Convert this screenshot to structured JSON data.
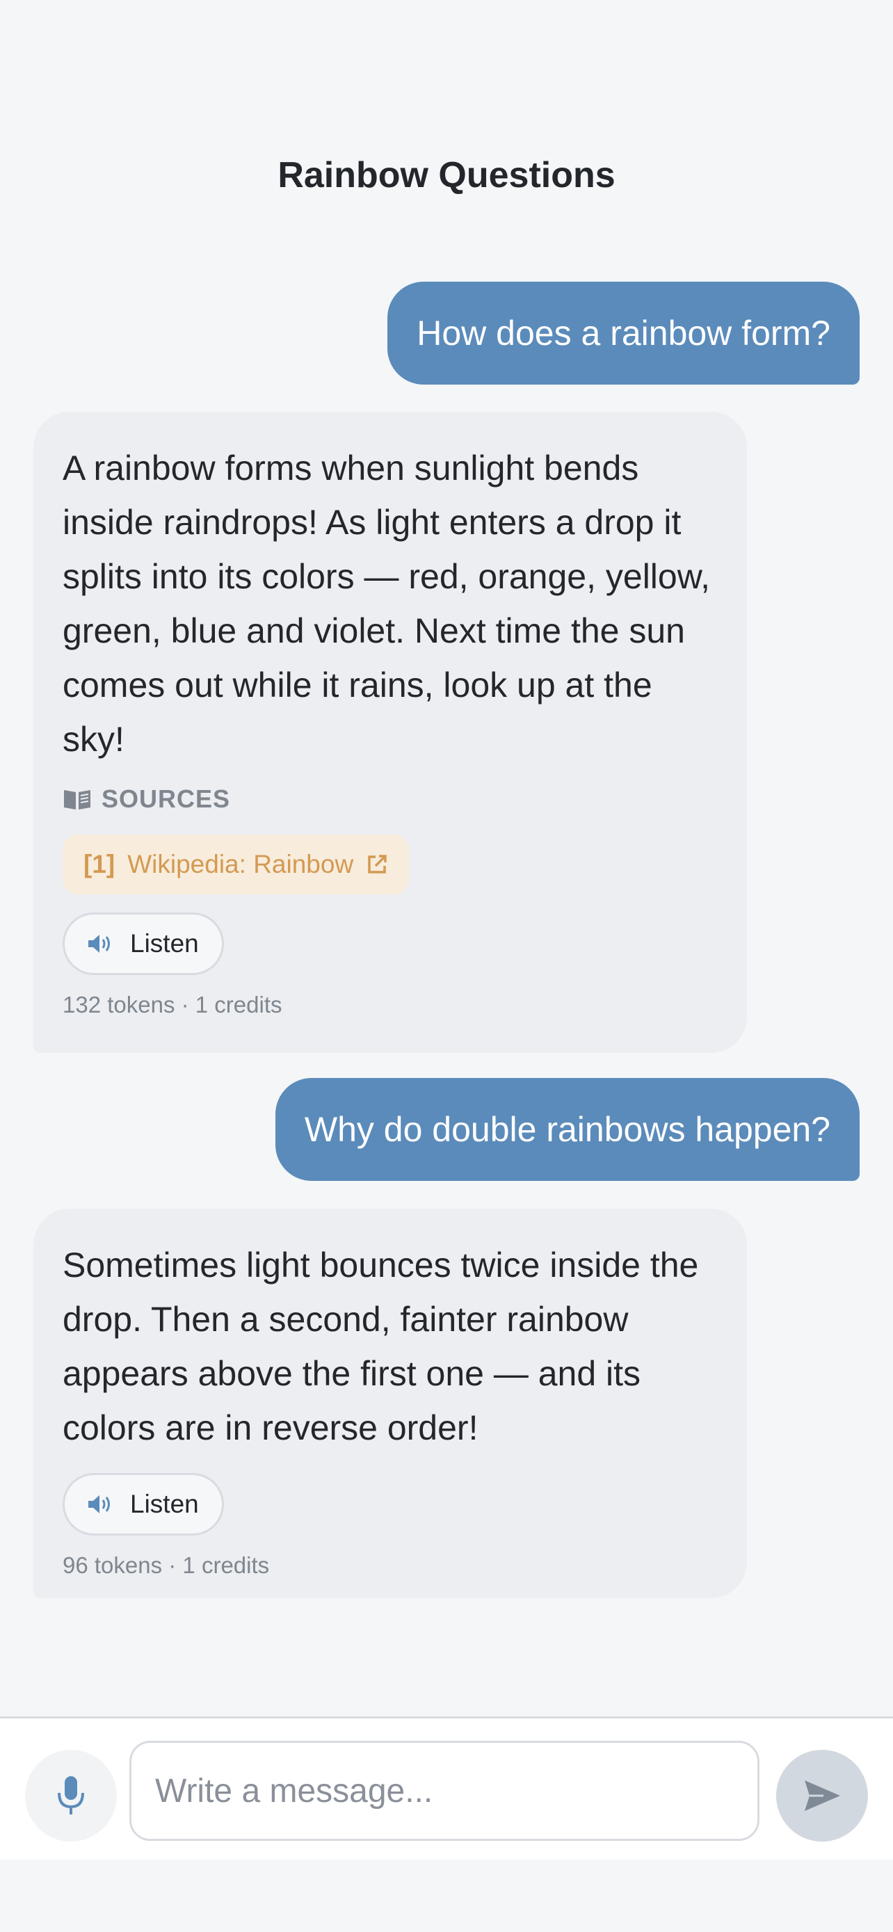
{
  "header": {
    "title": "Rainbow Questions"
  },
  "messages": [
    {
      "role": "user",
      "text": "How does a rainbow form?"
    },
    {
      "role": "assistant",
      "text": "A rainbow forms when sunlight bends inside raindrops! As light enters a drop it splits into its colors — red, orange, yellow, green, blue and violet. Next time the sun comes out while it rains, look up at the sky!",
      "sources_label": "SOURCES",
      "source": {
        "number": "[1]",
        "label": "Wikipedia: Rainbow"
      },
      "listen_label": "Listen",
      "meta": "132 tokens · 1 credits"
    },
    {
      "role": "user",
      "text": "Why do double rainbows happen?"
    },
    {
      "role": "assistant",
      "text": "Sometimes light bounces twice inside the drop. Then a second, fainter rainbow appears above the first one — and its colors are in reverse order!",
      "listen_label": "Listen",
      "meta": "96 tokens · 1 credits"
    }
  ],
  "composer": {
    "placeholder": "Write a message...",
    "mic_icon": "microphone-icon",
    "send_icon": "send-icon"
  },
  "colors": {
    "user_bubble": "#5b8bba",
    "assistant_bubble": "#eceef1",
    "source_chip_bg": "#f8ecdc",
    "source_chip_text": "#d39a52",
    "background": "#f4f6f8"
  }
}
